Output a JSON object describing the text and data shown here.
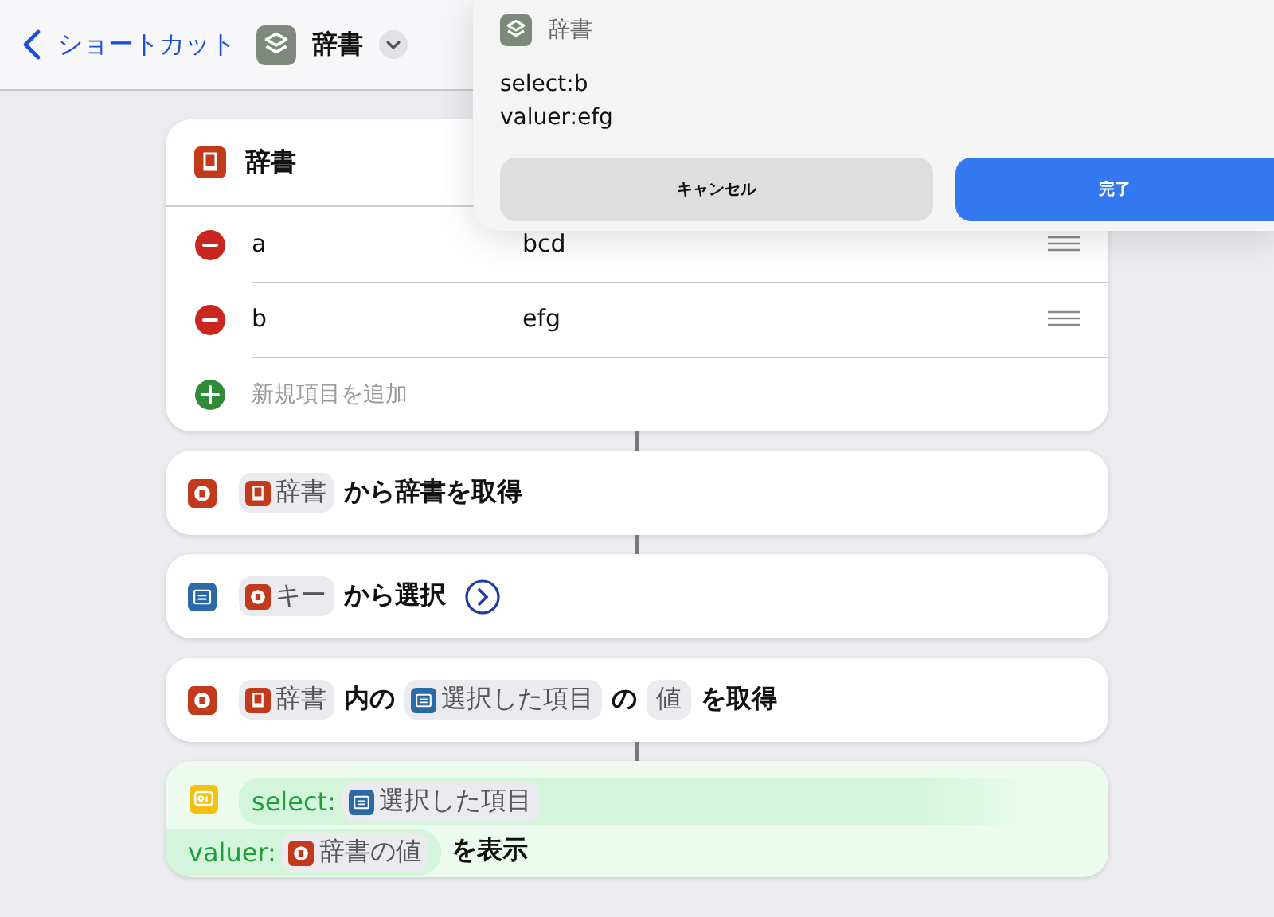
{
  "header": {
    "back_label": "ショートカット",
    "title": "辞書"
  },
  "dialog": {
    "title": "辞書",
    "lines": [
      "select:b",
      "valuer:efg"
    ],
    "buttons": [
      {
        "label": "キャンセル",
        "kind": "secondary"
      },
      {
        "label": "完了",
        "kind": "primary"
      }
    ]
  },
  "actions": [
    {
      "kind": "dictionary",
      "linked_above": false,
      "title": "辞書",
      "rows": [
        {
          "key": "a",
          "value": "bcd"
        },
        {
          "key": "b",
          "value": "efg"
        }
      ],
      "add_label": "新規項目を追加"
    },
    {
      "kind": "getdict",
      "linked_above": true,
      "lines": [
        [
          {
            "kind": "dictvar",
            "text": "辞書"
          },
          {
            "kind": "text",
            "text": "から辞書を取得"
          }
        ]
      ]
    },
    {
      "kind": "choose",
      "linked_above": true,
      "lines": [
        [
          {
            "kind": "resultvar",
            "text": "キー"
          },
          {
            "kind": "text",
            "text": "から選択"
          },
          {
            "kind": "expand"
          }
        ]
      ]
    },
    {
      "kind": "getvalue",
      "linked_above": false,
      "lines": [
        [
          {
            "kind": "dictvar",
            "text": "辞書"
          },
          {
            "kind": "text",
            "text": "内の"
          },
          {
            "kind": "itemvar",
            "text": "選択した項目"
          },
          {
            "kind": "text",
            "text": "の"
          },
          {
            "kind": "param",
            "text": "値"
          },
          {
            "kind": "text",
            "text": "を取得"
          }
        ]
      ]
    },
    {
      "kind": "show",
      "linked_above": true,
      "lines": [
        [
          {
            "kind": "band",
            "label": "select:",
            "token": {
              "kind": "itemvar",
              "text": "選択した項目"
            }
          }
        ],
        [
          {
            "kind": "band",
            "label": "valuer:",
            "token": {
              "kind": "resultvar",
              "text": "辞書の値"
            }
          },
          {
            "kind": "text",
            "text": "を表示"
          }
        ]
      ]
    }
  ]
}
